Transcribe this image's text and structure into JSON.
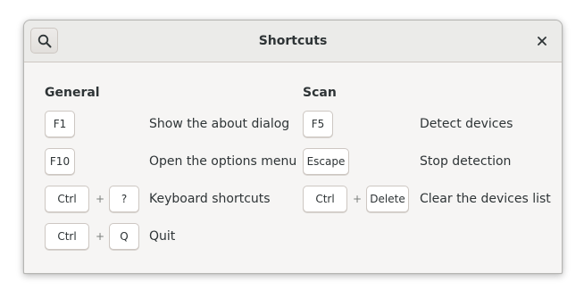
{
  "window": {
    "title": "Shortcuts",
    "close_icon": "close-icon",
    "search_icon": "search-icon"
  },
  "sections": {
    "general": {
      "title": "General",
      "shortcuts": [
        {
          "keys": [
            "F1"
          ],
          "description": "Show the about dialog"
        },
        {
          "keys": [
            "F10"
          ],
          "description": "Open the options menu"
        },
        {
          "keys": [
            "Ctrl",
            "?"
          ],
          "description": "Keyboard shortcuts"
        },
        {
          "keys": [
            "Ctrl",
            "Q"
          ],
          "description": "Quit"
        }
      ]
    },
    "scan": {
      "title": "Scan",
      "shortcuts": [
        {
          "keys": [
            "F5"
          ],
          "description": "Detect devices"
        },
        {
          "keys": [
            "Escape"
          ],
          "description": "Stop detection"
        },
        {
          "keys": [
            "Ctrl",
            "Delete"
          ],
          "description": "Clear the devices list"
        }
      ]
    }
  },
  "separator": "+"
}
